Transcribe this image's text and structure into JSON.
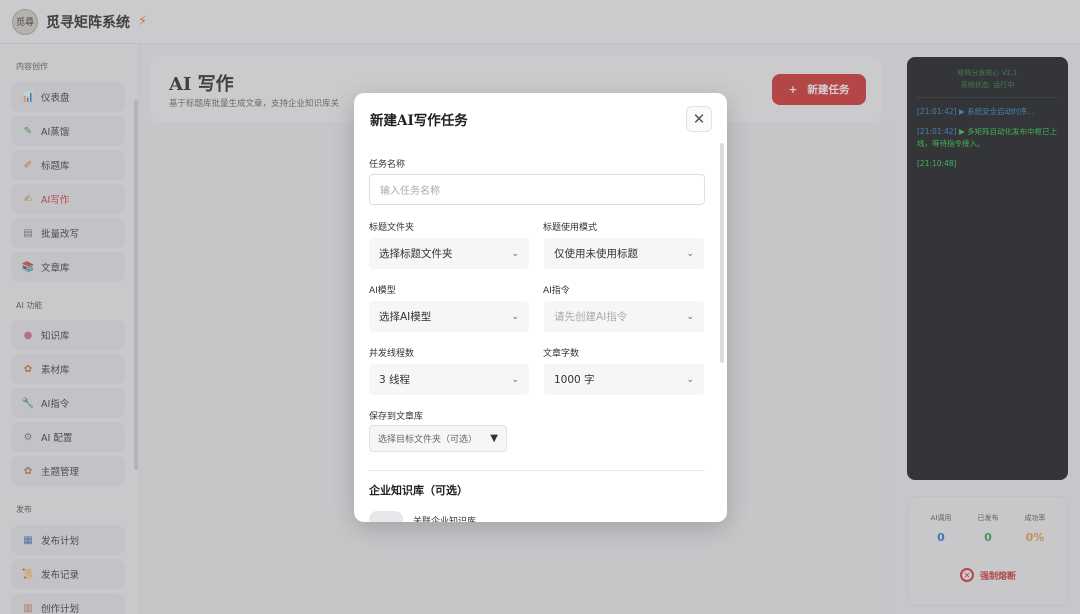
{
  "app": {
    "title": "觅寻矩阵系统",
    "logo_text": "觅尋",
    "bolt_icon": "lightning-icon"
  },
  "sidebar": {
    "sections": [
      {
        "label": "内容创作",
        "items": [
          {
            "label": "仪表盘",
            "icon": "chart-icon"
          },
          {
            "label": "AI蒸馏",
            "icon": "pencil-icon"
          },
          {
            "label": "标题库",
            "icon": "edit-icon"
          },
          {
            "label": "AI写作",
            "icon": "write-icon",
            "active": true
          },
          {
            "label": "批量改写",
            "icon": "doc-icon"
          },
          {
            "label": "文章库",
            "icon": "books-icon"
          }
        ]
      },
      {
        "label": "AI 功能",
        "items": [
          {
            "label": "知识库",
            "icon": "brain-icon"
          },
          {
            "label": "素材库",
            "icon": "palette-icon"
          },
          {
            "label": "AI指令",
            "icon": "wrench-icon"
          },
          {
            "label": "AI 配置",
            "icon": "gear-icon"
          },
          {
            "label": "主题管理",
            "icon": "theme-icon"
          }
        ]
      },
      {
        "label": "发布",
        "items": [
          {
            "label": "发布计划",
            "icon": "calendar-icon"
          },
          {
            "label": "发布记录",
            "icon": "scroll-icon"
          },
          {
            "label": "创作计划",
            "icon": "plan-icon"
          }
        ]
      }
    ]
  },
  "page": {
    "title": "AI 写作",
    "subtitle": "基于标题库批量生成文章，支持企业知识库关",
    "new_task_label": "新建任务"
  },
  "terminal": {
    "header_line1": "矩阵分发核心 V2.1",
    "header_line2": "系统状态: 运行中",
    "logs": [
      {
        "time": "[21:01:42]",
        "text": "▶ 系统安全启动时序...",
        "color": "blue"
      },
      {
        "time": "[21:01:42]",
        "text": "▶ 多矩阵自动化发布中枢已上线，等待指令接入。",
        "color": "green"
      },
      {
        "time": "[21:10:48]",
        "text": "",
        "color": "green"
      }
    ]
  },
  "stats": {
    "ai_calls": {
      "label": "AI调用",
      "value": "0",
      "color": "#2e6fd8"
    },
    "published": {
      "label": "已发布",
      "value": "0",
      "color": "#2ea44f"
    },
    "success_rate": {
      "label": "成功率",
      "value": "0%",
      "color": "#e6a23c"
    },
    "fuse_label": "强制熔断"
  },
  "modal": {
    "title": "新建AI写作任务",
    "close_icon": "close-icon",
    "task_name_label": "任务名称",
    "task_name_placeholder": "输入任务名称",
    "title_folder_label": "标题文件夹",
    "title_folder_value": "选择标题文件夹",
    "title_mode_label": "标题使用模式",
    "title_mode_value": "仅使用未使用标题",
    "ai_model_label": "AI模型",
    "ai_model_value": "选择AI模型",
    "ai_prompt_label": "AI指令",
    "ai_prompt_value": "请先创建AI指令",
    "threads_label": "并发线程数",
    "threads_value": "3 线程",
    "word_count_label": "文章字数",
    "word_count_value": "1000 字",
    "save_label": "保存到文章库",
    "save_value": "选择目标文件夹（可选）",
    "kb_section_title": "企业知识库（可选）",
    "kb_toggle_label": "关联企业知识库"
  }
}
